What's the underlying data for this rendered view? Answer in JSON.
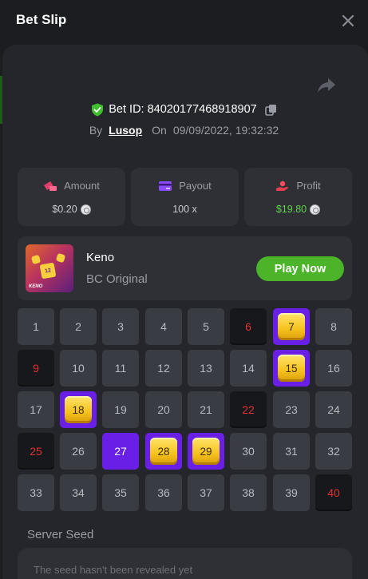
{
  "header": {
    "title": "Bet Slip"
  },
  "bet": {
    "id_text": "Bet ID: 84020177468918907",
    "by_label": "By",
    "user": "Lusop",
    "on_label": "On",
    "datetime": "09/09/2022, 19:32:32"
  },
  "stats": {
    "amount": {
      "label": "Amount",
      "value": "$0.20",
      "icon": "money-icon"
    },
    "payout": {
      "label": "Payout",
      "value": "100 x",
      "icon": "card-icon"
    },
    "profit": {
      "label": "Profit",
      "value": "$19.80",
      "icon": "hand-coin-icon"
    }
  },
  "game": {
    "name": "Keno",
    "subtitle": "BC Original",
    "play_label": "Play Now",
    "thumb_tile_1": "12",
    "thumb_caption": "KENO"
  },
  "colors": {
    "accent_purple": "#6a1fe6",
    "play_green": "#4bb429",
    "miss_red": "#e03131",
    "profit_green": "#5fd34a"
  },
  "keno": {
    "cells": [
      {
        "n": "1",
        "state": "normal"
      },
      {
        "n": "2",
        "state": "normal"
      },
      {
        "n": "3",
        "state": "normal"
      },
      {
        "n": "4",
        "state": "normal"
      },
      {
        "n": "5",
        "state": "normal"
      },
      {
        "n": "6",
        "state": "miss"
      },
      {
        "n": "7",
        "state": "hit"
      },
      {
        "n": "8",
        "state": "normal"
      },
      {
        "n": "9",
        "state": "miss"
      },
      {
        "n": "10",
        "state": "normal"
      },
      {
        "n": "11",
        "state": "normal"
      },
      {
        "n": "12",
        "state": "normal"
      },
      {
        "n": "13",
        "state": "normal"
      },
      {
        "n": "14",
        "state": "normal"
      },
      {
        "n": "15",
        "state": "hit"
      },
      {
        "n": "16",
        "state": "normal"
      },
      {
        "n": "17",
        "state": "normal"
      },
      {
        "n": "18",
        "state": "hit"
      },
      {
        "n": "19",
        "state": "normal"
      },
      {
        "n": "20",
        "state": "normal"
      },
      {
        "n": "21",
        "state": "normal"
      },
      {
        "n": "22",
        "state": "miss"
      },
      {
        "n": "23",
        "state": "normal"
      },
      {
        "n": "24",
        "state": "normal"
      },
      {
        "n": "25",
        "state": "miss"
      },
      {
        "n": "26",
        "state": "normal"
      },
      {
        "n": "27",
        "state": "pick"
      },
      {
        "n": "28",
        "state": "hit"
      },
      {
        "n": "29",
        "state": "hit"
      },
      {
        "n": "30",
        "state": "normal"
      },
      {
        "n": "31",
        "state": "normal"
      },
      {
        "n": "32",
        "state": "normal"
      },
      {
        "n": "33",
        "state": "normal"
      },
      {
        "n": "34",
        "state": "normal"
      },
      {
        "n": "35",
        "state": "normal"
      },
      {
        "n": "36",
        "state": "normal"
      },
      {
        "n": "37",
        "state": "normal"
      },
      {
        "n": "38",
        "state": "normal"
      },
      {
        "n": "39",
        "state": "normal"
      },
      {
        "n": "40",
        "state": "miss"
      }
    ]
  },
  "seed": {
    "title": "Server Seed",
    "text": "The seed hasn't been revealed yet"
  }
}
